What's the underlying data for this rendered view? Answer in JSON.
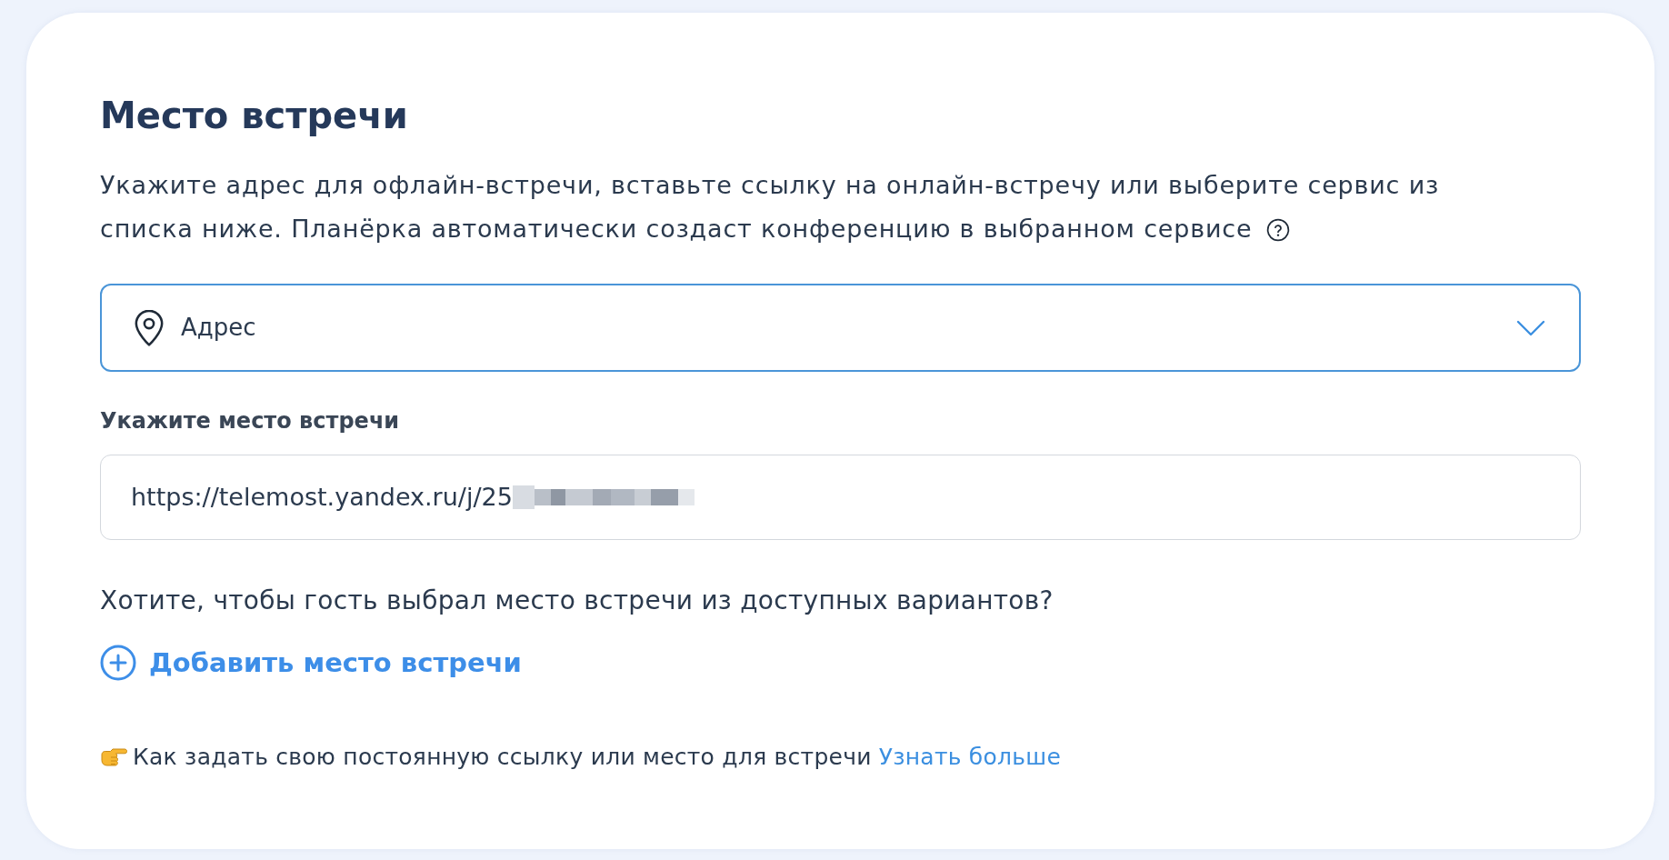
{
  "title": "Место встречи",
  "description": "Укажите адрес для офлайн-встречи, вставьте ссылку на онлайн-встречу или выберите сервис из списка ниже. Планёрка автоматически создаст конференцию в выбранном сервисе",
  "location_type": {
    "value": "Адрес"
  },
  "meeting_place": {
    "label": "Укажите место встречи",
    "value": "https://telemost.yandex.ru/j/25"
  },
  "guest_choice_question": "Хотите, чтобы гость выбрал место встречи из доступных вариантов?",
  "add_button": "Добавить место встречи",
  "hint": {
    "text": "Как задать свою постоянную ссылку или место для встречи",
    "link": "Узнать больше"
  }
}
